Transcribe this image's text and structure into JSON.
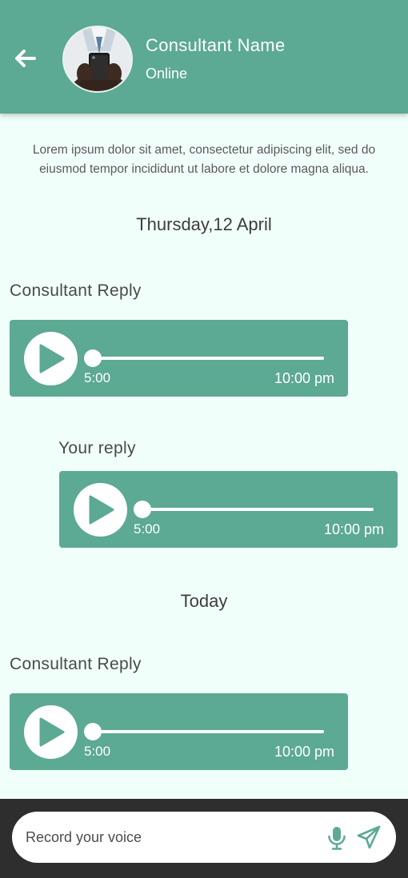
{
  "header": {
    "name": "Consultant Name",
    "status": "Online",
    "back_icon": "arrow-left-icon"
  },
  "intro_text": "Lorem ipsum dolor sit amet, consectetur adipiscing elit, sed do eiusmod tempor incididunt ut labore et dolore magna aliqua.",
  "date_separators": [
    "Thursday,12 April",
    "Today"
  ],
  "messages": [
    {
      "sender": "Consultant Reply",
      "duration": "5:00",
      "time": "10:00 pm",
      "progress": 0
    },
    {
      "sender": "Your reply",
      "duration": "5:00",
      "time": "10:00 pm",
      "progress": 0
    },
    {
      "sender": "Consultant Reply",
      "duration": "5:00",
      "time": "10:00 pm",
      "progress": 0
    }
  ],
  "composer": {
    "placeholder": "Record your voice",
    "mic_icon": "microphone-icon",
    "send_icon": "send-icon"
  },
  "colors": {
    "accent": "#5ca994",
    "background": "#f1fffb",
    "bottom_bar": "#2e2e2e",
    "text_dark": "#4a4a4a"
  }
}
